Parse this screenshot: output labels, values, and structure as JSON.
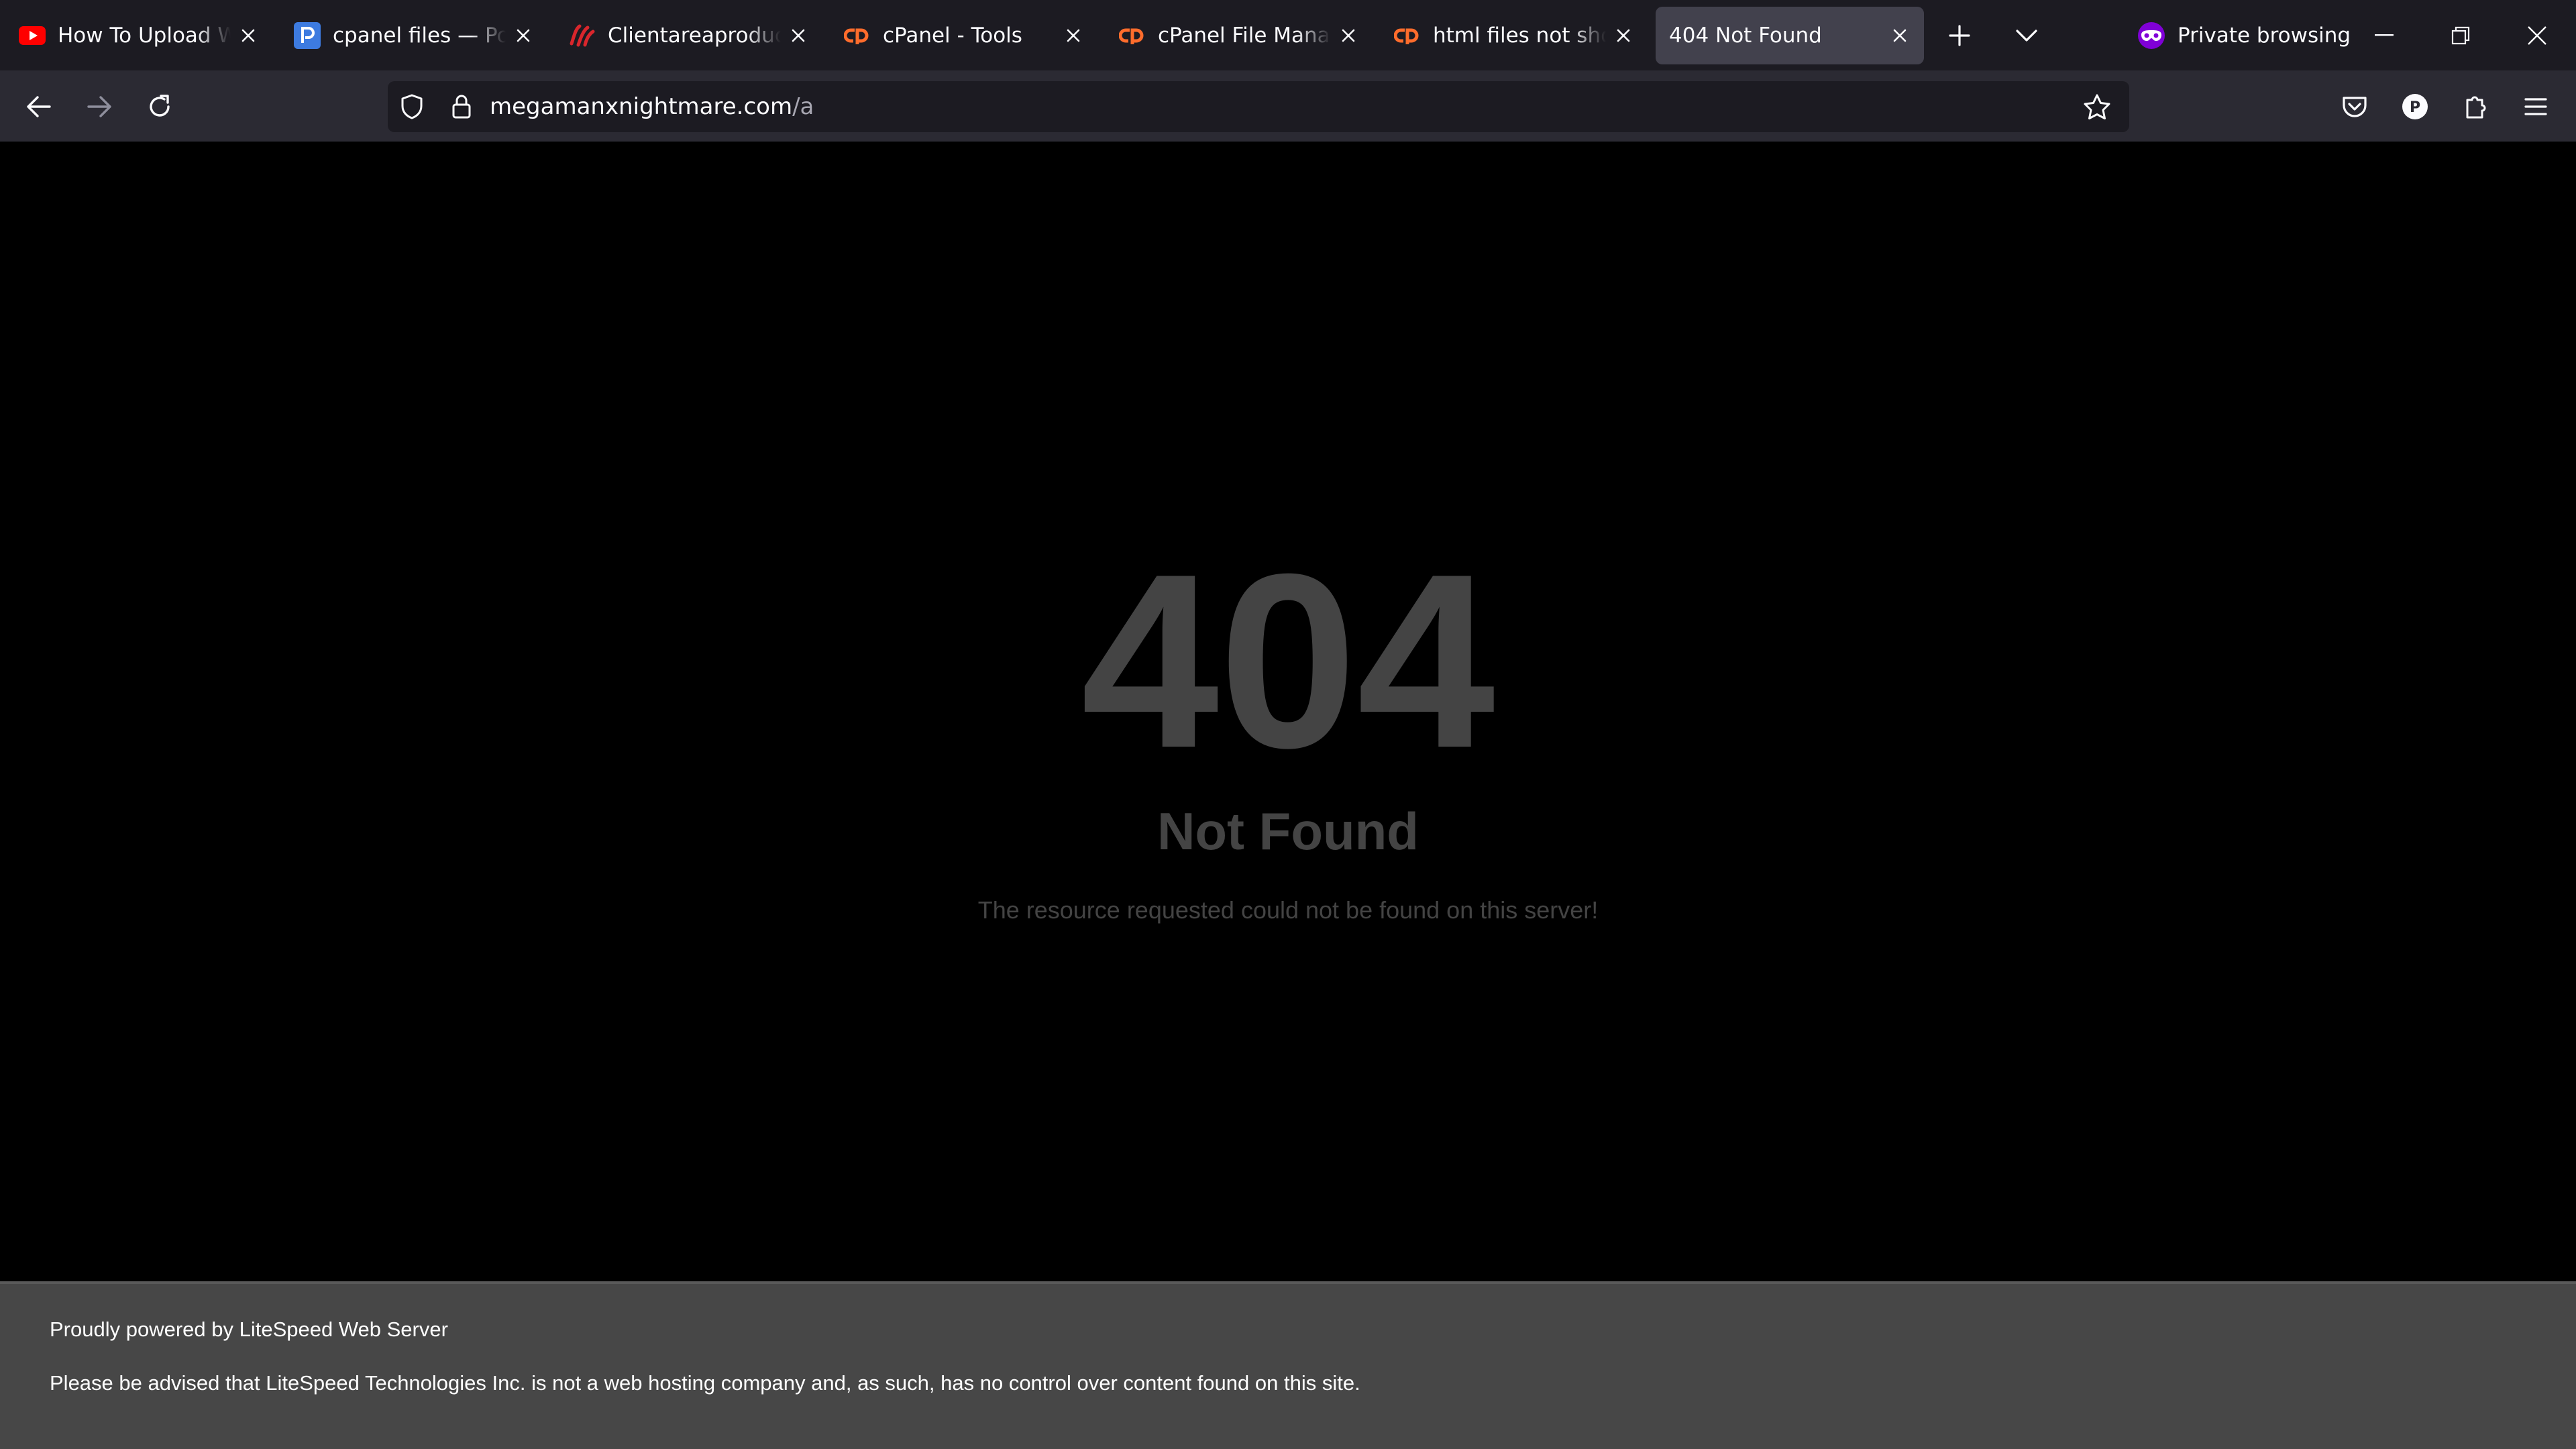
{
  "browser": {
    "tabs": [
      {
        "title": "How To Upload Website",
        "favicon": "youtube-icon",
        "color": "#ff0000",
        "active": false
      },
      {
        "title": "cpanel files — Posting",
        "favicon": "postimages-icon",
        "color": "#3d7be0",
        "active": false
      },
      {
        "title": "Clientareaproductdetails",
        "favicon": "hosting-logo-icon",
        "color": "#d9262c",
        "active": false
      },
      {
        "title": "cPanel - Tools",
        "favicon": "cpanel-icon",
        "color": "#ff6c2c",
        "active": false
      },
      {
        "title": "cPanel File Manager",
        "favicon": "cpanel-icon",
        "color": "#ff6c2c",
        "active": false
      },
      {
        "title": "html files not showing",
        "favicon": "cpanel-icon",
        "color": "#ff6c2c",
        "active": false
      },
      {
        "title": "404 Not Found",
        "favicon": "",
        "color": "",
        "active": true
      }
    ],
    "private_browsing_label": "Private browsing",
    "private_color": "#8000d7",
    "url": {
      "host": "megamanxnightmare.com",
      "path": "/a"
    },
    "profile_initial": "P"
  },
  "page": {
    "code": "404",
    "title": "Not Found",
    "message": "The resource requested could not be found on this server!",
    "footer_powered": "Proudly powered by LiteSpeed Web Server",
    "footer_notice": "Please be advised that LiteSpeed Technologies Inc. is not a web hosting company and, as such, has no control over content found on this site."
  }
}
